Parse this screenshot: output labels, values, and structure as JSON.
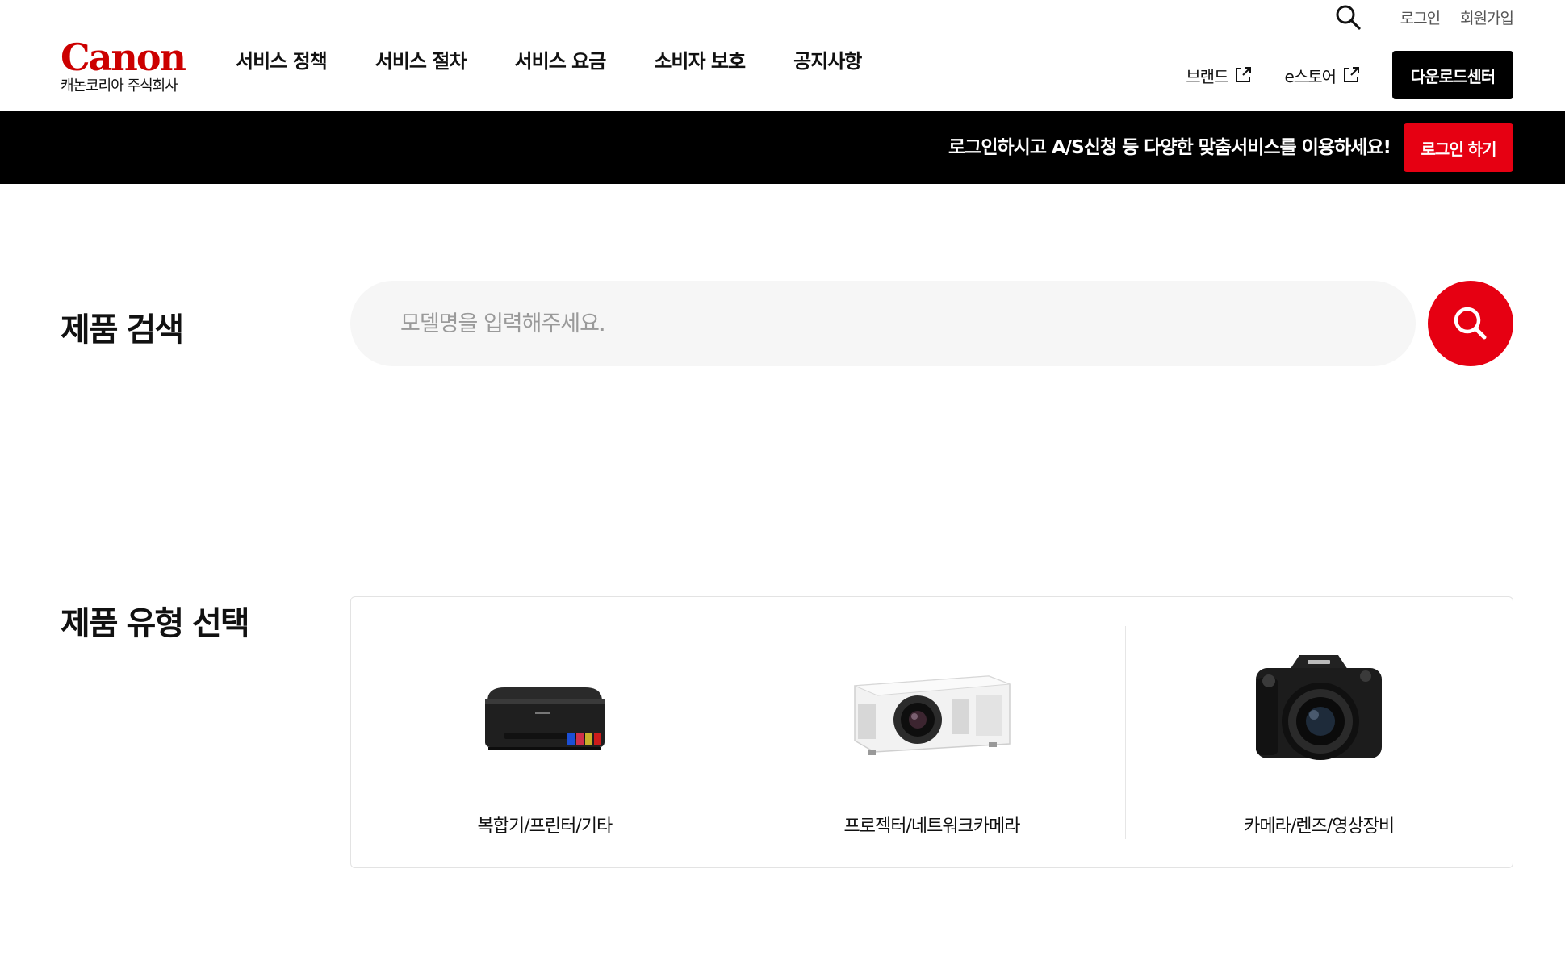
{
  "header": {
    "logo_mark": "Canon",
    "logo_sub": "캐논코리아 주식회사",
    "nav": [
      "서비스 정책",
      "서비스 절차",
      "서비스 요금",
      "소비자 보호",
      "공지사항"
    ],
    "util_login": "로그인",
    "util_join": "회원가입",
    "brand_link": "브랜드",
    "estore_link": "e스토어",
    "download_center": "다운로드센터"
  },
  "banner": {
    "text": "로그인하시고 A/S신청 등 다양한 맞춤서비스를 이용하세요!",
    "login_button": "로그인 하기"
  },
  "search": {
    "title": "제품 검색",
    "placeholder": "모델명을 입력해주세요."
  },
  "product_types": {
    "title": "제품 유형 선택",
    "items": [
      {
        "label": "복합기/프린터/기타",
        "icon": "printer-icon"
      },
      {
        "label": "프로젝터/네트워크카메라",
        "icon": "projector-icon"
      },
      {
        "label": "카메라/렌즈/영상장비",
        "icon": "camera-icon"
      }
    ]
  },
  "colors": {
    "brand_red": "#cc0000",
    "accent_red": "#e60012",
    "banner_black": "#000000"
  }
}
